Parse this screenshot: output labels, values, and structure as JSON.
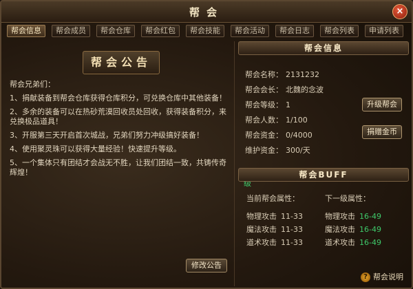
{
  "window": {
    "title": "帮会",
    "close_label": "×"
  },
  "tabs": [
    {
      "label": "帮会信息",
      "active": true
    },
    {
      "label": "帮会成员"
    },
    {
      "label": "帮会仓库"
    },
    {
      "label": "帮会红包"
    },
    {
      "label": "帮会技能"
    },
    {
      "label": "帮会活动"
    },
    {
      "label": "帮会日志"
    },
    {
      "label": "帮会列表"
    },
    {
      "label": "申请列表"
    }
  ],
  "notice": {
    "title": "帮会公告",
    "lines": [
      "帮会兄弟们：",
      "1、捐献装备到帮会仓库获得仓库积分，可兑换仓库中其他装备！",
      "2、多余的装备可以在热砂荒漠回收员处回收，获得装备积分，来兑换极品道具！",
      "3、开服第三天开启首次城战，兄弟们努力冲级搞好装备！",
      "4、使用聚灵珠可以获得大量经验！快速提升等级。",
      "5、一个集体只有团结才会战无不胜，让我们团结一致，共铸传奇辉煌！"
    ],
    "edit_button": "修改公告"
  },
  "guild_info": {
    "header": "帮会信息",
    "name_label": "帮会名称：",
    "name_value": "2131232",
    "leader_label": "帮会会长：",
    "leader_value": "北魏的念波",
    "level_label": "帮会等级：",
    "level_value": "1",
    "members_label": "帮会人数：",
    "members_value": "1/100",
    "funds_label": "帮会资金：",
    "funds_value": "0/4000",
    "maintenance_label": "维护资金：",
    "maintenance_value": "300/天",
    "upgrade_button": "升级帮会",
    "donate_button": "捐赠金币",
    "tip": "捐赠金币可获得帮会贡献，用来提升帮会技能等级"
  },
  "buff": {
    "header": "帮会BUFF",
    "current_header": "当前帮会属性：",
    "next_header": "下一级属性：",
    "current": [
      {
        "label": "物理攻击",
        "value": "11-33"
      },
      {
        "label": "魔法攻击",
        "value": "11-33"
      },
      {
        "label": "道术攻击",
        "value": "11-33"
      }
    ],
    "next": [
      {
        "label": "物理攻击",
        "value": "16-49"
      },
      {
        "label": "魔法攻击",
        "value": "16-49"
      },
      {
        "label": "道术攻击",
        "value": "16-49"
      }
    ]
  },
  "help": {
    "label": "帮会说明"
  },
  "colors": {
    "accent_green": "#3ec96a",
    "gold_border": "#b0976f"
  }
}
